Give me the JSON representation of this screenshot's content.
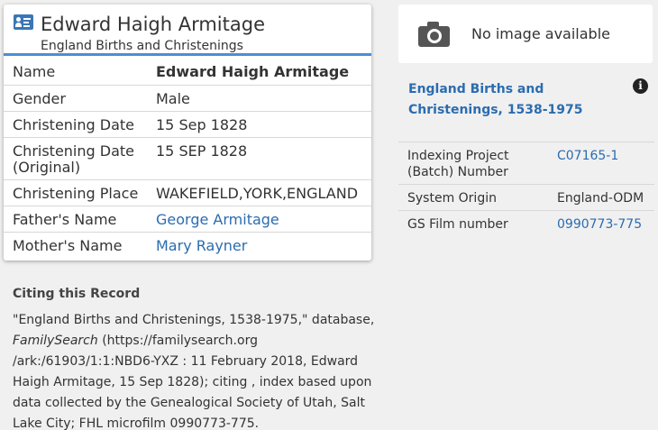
{
  "record": {
    "name_title": "Edward Haigh Armitage",
    "collection_subtitle": "England Births and Christenings",
    "rows": [
      {
        "label": "Name",
        "value": "Edward Haigh Armitage"
      },
      {
        "label": "Gender",
        "value": "Male"
      },
      {
        "label": "Christening Date",
        "value": "15 Sep 1828"
      },
      {
        "label": "Christening Date (Original)",
        "value": "15 SEP 1828"
      },
      {
        "label": "Christening Place",
        "value": "WAKEFIELD,YORK,ENGLAND"
      },
      {
        "label": "Father's Name",
        "value": "George Armitage"
      },
      {
        "label": "Mother's Name",
        "value": "Mary Rayner"
      }
    ]
  },
  "citation": {
    "heading": "Citing this Record",
    "text_part1": "\"England Births and Christenings, 1538-1975,\" database, ",
    "text_italic": "FamilySearch",
    "text_part2": " (https://familysearch.org /ark:/61903/1:1:NBD6-YXZ : 11 February 2018, Edward Haigh Armitage, 15 Sep 1828); citing , index based upon data collected by the Genealogical Society of Utah, Salt Lake City; FHL microfilm 0990773-775."
  },
  "image_panel": {
    "icon": "camera-icon",
    "text": "No image available"
  },
  "collection": {
    "title": "England Births and Christenings, 1538-1975",
    "info_icon": "info-icon",
    "rows": [
      {
        "label": "Indexing Project (Batch) Number",
        "value": "C07165-1"
      },
      {
        "label": "System Origin",
        "value": "England-ODM"
      },
      {
        "label": "GS Film number",
        "value": "0990773-775"
      }
    ]
  },
  "colors": {
    "link": "#2b6cb0",
    "accent_bar": "#4a8fd4",
    "background": "#f0f0f0"
  }
}
